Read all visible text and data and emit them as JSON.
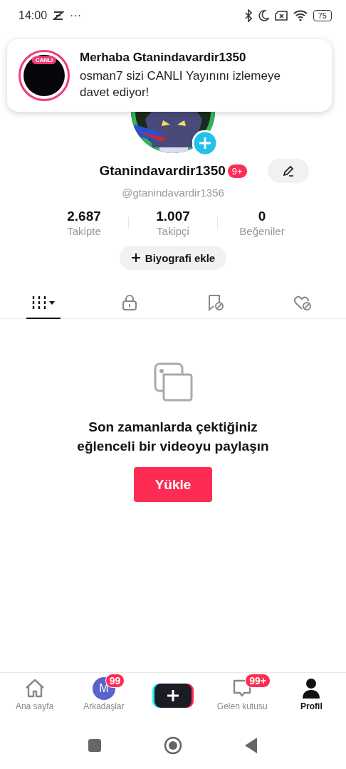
{
  "status_bar": {
    "time": "14:00",
    "more": "···",
    "battery": "75"
  },
  "notification": {
    "badge": "CANLI",
    "title": "Merhaba Gtanindavardir1350",
    "message": "osman7 sizi CANLI Yayınını izlemeye davet ediyor!"
  },
  "profile": {
    "name": "Gtanindavardir1350",
    "name_badge": "9+",
    "handle": "@gtanindavardir1356",
    "stats": [
      {
        "value": "2.687",
        "label": "Takipte"
      },
      {
        "value": "1.007",
        "label": "Takipçi"
      },
      {
        "value": "0",
        "label": "Beğeniler"
      }
    ],
    "bio_button": "Biyografi ekle"
  },
  "tabs": [
    {
      "kind": "videos",
      "selected": true
    },
    {
      "kind": "private",
      "selected": false
    },
    {
      "kind": "saved",
      "selected": false
    },
    {
      "kind": "liked",
      "selected": false
    }
  ],
  "empty_state": {
    "message": "Son zamanlarda çektiğiniz eğlenceli bir videoyu paylaşın",
    "button": "Yükle"
  },
  "bottom_nav": [
    {
      "kind": "home",
      "label": "Ana sayfa",
      "selected": false
    },
    {
      "kind": "friends",
      "label": "Arkadaşlar",
      "avatar": "M",
      "badge": "99",
      "selected": false
    },
    {
      "kind": "create",
      "selected": false
    },
    {
      "kind": "inbox",
      "label": "Gelen kutusu",
      "badge": "99+",
      "selected": false
    },
    {
      "kind": "profile",
      "label": "Profil",
      "selected": true
    }
  ]
}
